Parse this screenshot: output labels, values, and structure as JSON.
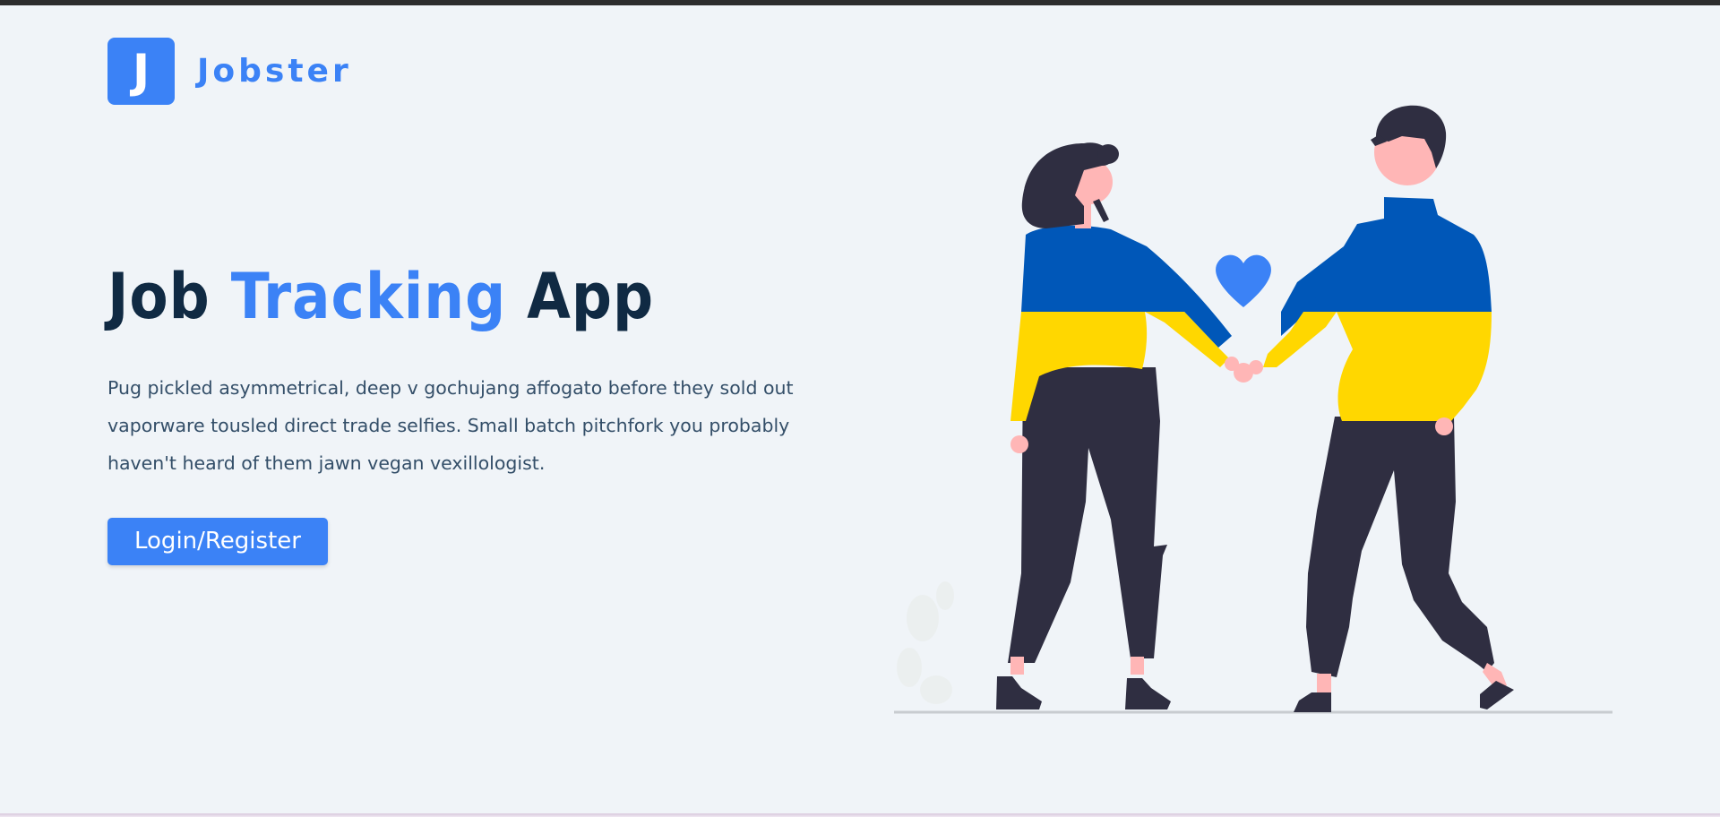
{
  "brand": {
    "logo_letter": "J",
    "name": "Jobster",
    "accent_color": "#3b82f6"
  },
  "hero": {
    "title_part1": "Job ",
    "title_accent": "Tracking",
    "title_part2": " App",
    "description": "Pug pickled asymmetrical, deep v gochujang affogato before they sold out vaporware tousled direct trade selfies. Small batch pitchfork you probably haven't heard of them jawn vegan vexillologist.",
    "cta_label": "Login/Register"
  },
  "illustration": {
    "icon": "couple-holding-hands-illustration",
    "heart_icon": "heart-icon",
    "colors": {
      "blue": "#0057b8",
      "yellow": "#ffd700",
      "dark": "#2f2e41",
      "skin": "#ffb6b6",
      "heart": "#3b82f6"
    }
  }
}
